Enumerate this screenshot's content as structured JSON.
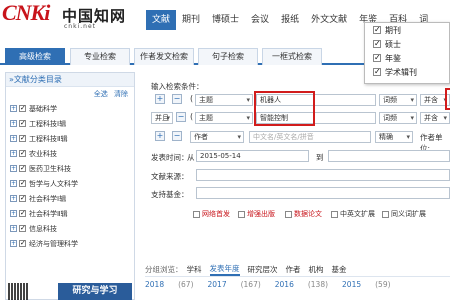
{
  "logo": {
    "main": "CNKi",
    "cn": "中国知网",
    "net": "cnki.net"
  },
  "nav": [
    "文献",
    "期刊",
    "博硕士",
    "会议",
    "报纸",
    "外文文献",
    "年鉴",
    "百科",
    "词"
  ],
  "tabs": [
    "高级检索",
    "专业检索",
    "作者发文检索",
    "句子检索",
    "一框式检索"
  ],
  "left": {
    "title": "文献分类目录",
    "select_all": "全选",
    "clear": "清除",
    "categories": [
      "基础科学",
      "工程科技Ⅰ辑",
      "工程科技Ⅱ辑",
      "农业科技",
      "医药卫生科技",
      "哲学与人文科学",
      "社会科学Ⅰ辑",
      "社会科学Ⅱ辑",
      "信息科技",
      "经济与管理科学"
    ],
    "banner": "研究与学习"
  },
  "search": {
    "input_label": "输入检索条件：",
    "row1": {
      "field": "主题",
      "value": "机器人",
      "freq": "词频",
      "logic": "并含"
    },
    "row2": {
      "logic": "并且",
      "field": "主题",
      "value": "智能控制",
      "freq": "词频",
      "logic2": "并含"
    },
    "row3": {
      "field": "作者",
      "placeholder": "中文名/英文名/拼音",
      "match": "精确",
      "unit": "作者单位:"
    },
    "date_label": "发表时间：",
    "date_from_label": "从",
    "date_from": "2015-05-14",
    "date_to_label": "到",
    "source_label": "文献来源：",
    "fund_label": "支持基金：",
    "options": [
      "网络首发",
      "增强出版",
      "数据论文",
      "中英文扩展",
      "同义词扩展"
    ]
  },
  "bottom": {
    "lead": "分组浏览：",
    "tabs": [
      "学科",
      "发表年度",
      "研究层次",
      "作者",
      "机构",
      "基金"
    ],
    "years": [
      {
        "year": "2018",
        "count": "(67)"
      },
      {
        "year": "2017",
        "count": "(167)"
      },
      {
        "year": "2016",
        "count": "(138)"
      },
      {
        "year": "2015",
        "count": "(59)"
      }
    ]
  },
  "dropdown": [
    "期刊",
    "硕士",
    "年鉴",
    "学术辑刊"
  ],
  "colors": {
    "accent": "#2f6fb4",
    "brand_red": "#c8141b",
    "highlight": "#d11c1c"
  }
}
